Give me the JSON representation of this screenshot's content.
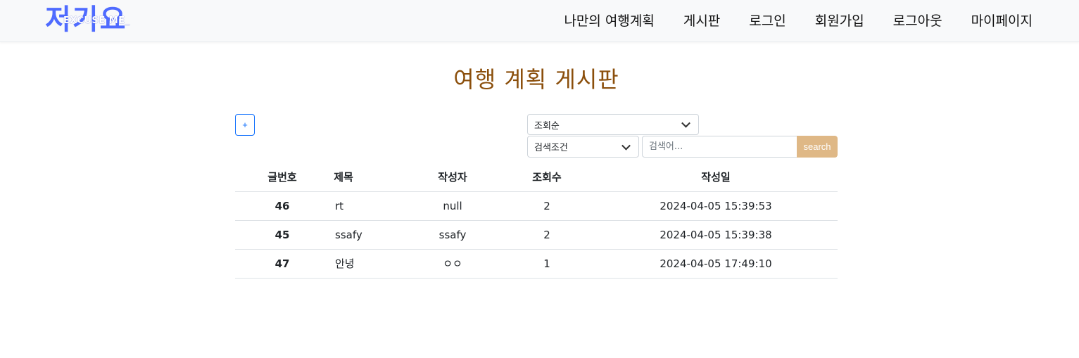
{
  "brand": {
    "logo_main": "저기요",
    "logo_sub": "EXCUSE ME_",
    "logo_color": "#4f6bff"
  },
  "nav": {
    "items": [
      "나만의 여행계획",
      "게시판",
      "로그인",
      "회원가입",
      "로그아웃",
      "마이페이지"
    ]
  },
  "page": {
    "title": "여행 계획 게시판",
    "title_color": "#8b4f0c"
  },
  "toolbar": {
    "add_label": "+",
    "sort_selected": "조회순",
    "condition_selected": "검색조건",
    "search_placeholder": "검색어...",
    "search_button": "search",
    "search_button_color": "#dfb886"
  },
  "table": {
    "headers": [
      "글번호",
      "제목",
      "작성자",
      "조회수",
      "작성일"
    ],
    "rows": [
      {
        "no": "46",
        "title": "rt",
        "author": "null",
        "views": "2",
        "date": "2024-04-05 15:39:53"
      },
      {
        "no": "45",
        "title": "ssafy",
        "author": "ssafy",
        "views": "2",
        "date": "2024-04-05 15:39:38"
      },
      {
        "no": "47",
        "title": "안녕",
        "author": "ㅇㅇ",
        "views": "1",
        "date": "2024-04-05 17:49:10"
      }
    ]
  }
}
